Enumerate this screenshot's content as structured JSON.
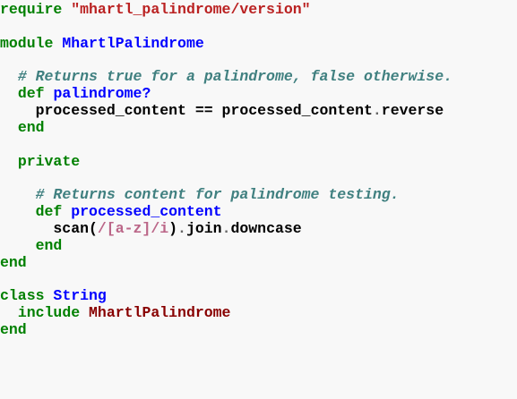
{
  "code_lines": [
    {
      "segments": [
        {
          "kind": "keyword",
          "text": "require"
        },
        {
          "kind": "plain",
          "text": " "
        },
        {
          "kind": "string",
          "text": "\"mhartl_palindrome/version\""
        }
      ]
    },
    {
      "segments": []
    },
    {
      "segments": [
        {
          "kind": "keyword",
          "text": "module"
        },
        {
          "kind": "plain",
          "text": " "
        },
        {
          "kind": "module",
          "text": "MhartlPalindrome"
        }
      ]
    },
    {
      "segments": []
    },
    {
      "segments": [
        {
          "kind": "plain",
          "text": "  "
        },
        {
          "kind": "comment",
          "text": "# Returns true for a palindrome, false otherwise."
        }
      ]
    },
    {
      "segments": [
        {
          "kind": "plain",
          "text": "  "
        },
        {
          "kind": "keyword",
          "text": "def"
        },
        {
          "kind": "plain",
          "text": " "
        },
        {
          "kind": "func",
          "text": "palindrome?"
        }
      ]
    },
    {
      "segments": [
        {
          "kind": "plain",
          "text": "    processed_content "
        },
        {
          "kind": "op",
          "text": "=="
        },
        {
          "kind": "plain",
          "text": " processed_content"
        },
        {
          "kind": "dot",
          "text": "."
        },
        {
          "kind": "plain",
          "text": "reverse"
        }
      ]
    },
    {
      "segments": [
        {
          "kind": "plain",
          "text": "  "
        },
        {
          "kind": "keyword",
          "text": "end"
        }
      ]
    },
    {
      "segments": []
    },
    {
      "segments": [
        {
          "kind": "plain",
          "text": "  "
        },
        {
          "kind": "keyword",
          "text": "private"
        }
      ]
    },
    {
      "segments": []
    },
    {
      "segments": [
        {
          "kind": "plain",
          "text": "    "
        },
        {
          "kind": "comment",
          "text": "# Returns content for palindrome testing."
        }
      ]
    },
    {
      "segments": [
        {
          "kind": "plain",
          "text": "    "
        },
        {
          "kind": "keyword",
          "text": "def"
        },
        {
          "kind": "plain",
          "text": " "
        },
        {
          "kind": "func",
          "text": "processed_content"
        }
      ]
    },
    {
      "segments": [
        {
          "kind": "plain",
          "text": "      scan("
        },
        {
          "kind": "regex",
          "text": "/[a-z]/i"
        },
        {
          "kind": "plain",
          "text": ")"
        },
        {
          "kind": "dot",
          "text": "."
        },
        {
          "kind": "plain",
          "text": "join"
        },
        {
          "kind": "dot",
          "text": "."
        },
        {
          "kind": "plain",
          "text": "downcase"
        }
      ]
    },
    {
      "segments": [
        {
          "kind": "plain",
          "text": "    "
        },
        {
          "kind": "keyword",
          "text": "end"
        }
      ]
    },
    {
      "segments": [
        {
          "kind": "keyword",
          "text": "end"
        }
      ]
    },
    {
      "segments": []
    },
    {
      "segments": [
        {
          "kind": "keyword",
          "text": "class"
        },
        {
          "kind": "plain",
          "text": " "
        },
        {
          "kind": "class",
          "text": "String"
        }
      ]
    },
    {
      "segments": [
        {
          "kind": "plain",
          "text": "  "
        },
        {
          "kind": "keyword",
          "text": "include"
        },
        {
          "kind": "plain",
          "text": " "
        },
        {
          "kind": "const",
          "text": "MhartlPalindrome"
        }
      ]
    },
    {
      "segments": [
        {
          "kind": "keyword",
          "text": "end"
        }
      ]
    }
  ],
  "colors": {
    "background": "#f8f8f8",
    "keyword": "#008000",
    "string": "#ba2121",
    "name": "#0000ff",
    "comment": "#408080",
    "regex": "#bb6688",
    "constant": "#880000"
  }
}
